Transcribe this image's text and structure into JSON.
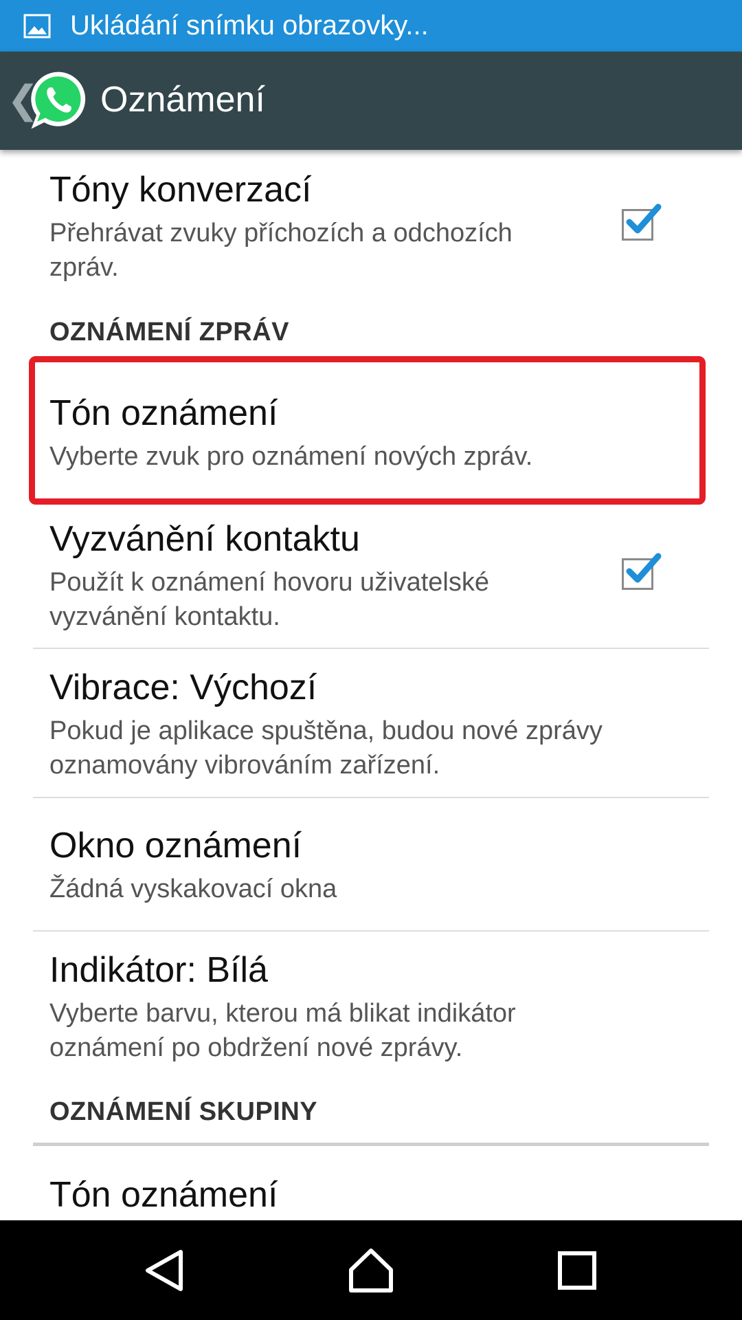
{
  "status_bar": {
    "text": "Ukládání snímku obrazovky..."
  },
  "action_bar": {
    "title": "Oznámení",
    "back_glyph": "❮"
  },
  "sections": {
    "message_notifications": "OZNÁMENÍ ZPRÁV",
    "group_notifications": "OZNÁMENÍ SKUPINY"
  },
  "prefs": {
    "conversation_tones": {
      "title": "Tóny konverzací",
      "summary": "Přehrávat zvuky příchozích a odchozích zpráv.",
      "checked": true
    },
    "notification_tone": {
      "title": "Tón oznámení",
      "summary": "Vyberte zvuk pro oznámení nových zpráv."
    },
    "contact_ringtone": {
      "title": "Vyzvánění kontaktu",
      "summary": "Použít k oznámení hovoru uživatelské vyzvánění kontaktu.",
      "checked": true
    },
    "vibrate": {
      "title": "Vibrace: Výchozí",
      "summary": "Pokud je aplikace spuštěna, budou nové zprávy oznamovány vibrováním zařízení."
    },
    "popup": {
      "title": "Okno oznámení",
      "summary": "Žádná vyskakovací okna"
    },
    "light": {
      "title": "Indikátor: Bílá",
      "summary": "Vyberte barvu, kterou má blikat indikátor oznámení po obdržení nové zprávy."
    },
    "group_tone": {
      "title": "Tón oznámení"
    }
  },
  "colors": {
    "status_bar": "#1E8FD8",
    "action_bar": "#33464B",
    "highlight": "#E41E26",
    "checkmark": "#1E8FD8",
    "whatsapp_green": "#25D366"
  },
  "icons": {
    "status": "image-icon",
    "app": "whatsapp-logo-icon",
    "nav": [
      "back-triangle-icon",
      "home-icon",
      "recents-square-icon"
    ]
  }
}
